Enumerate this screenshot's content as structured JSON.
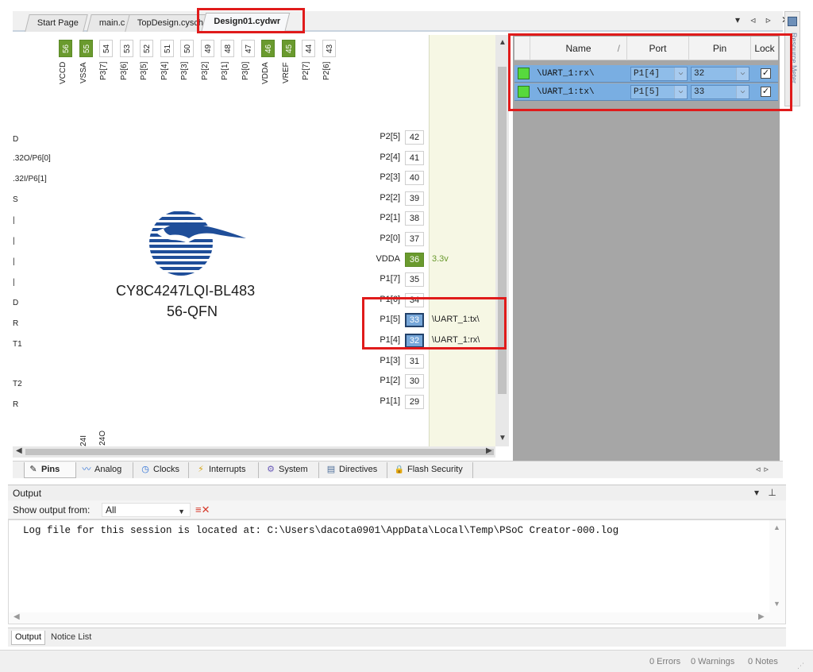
{
  "editor_tabs": [
    {
      "label": "Start Page"
    },
    {
      "label": "main.c"
    },
    {
      "label": "TopDesign.cysch"
    },
    {
      "label": "Design01.cydwr"
    }
  ],
  "tab_controls": "▾ ◃ ▹ ✕",
  "right_strip_text": "Resource Meter",
  "chip": {
    "name": "CY8C4247LQI-BL483",
    "package": "56-QFN",
    "top_pins": [
      {
        "num": "56",
        "name": "VCCD",
        "green": true
      },
      {
        "num": "55",
        "name": "VSSA",
        "green": true
      },
      {
        "num": "54",
        "name": "P3[7]",
        "green": false
      },
      {
        "num": "53",
        "name": "P3[6]",
        "green": false
      },
      {
        "num": "52",
        "name": "P3[5]",
        "green": false
      },
      {
        "num": "51",
        "name": "P3[4]",
        "green": false
      },
      {
        "num": "50",
        "name": "P3[3]",
        "green": false
      },
      {
        "num": "49",
        "name": "P3[2]",
        "green": false
      },
      {
        "num": "48",
        "name": "P3[1]",
        "green": false
      },
      {
        "num": "47",
        "name": "P3[0]",
        "green": false
      },
      {
        "num": "46",
        "name": "VDDA",
        "green": true
      },
      {
        "num": "45",
        "name": "VREF",
        "green": true
      },
      {
        "num": "44",
        "name": "P2[7]",
        "green": false
      },
      {
        "num": "43",
        "name": "P2[6]",
        "green": false
      }
    ],
    "left_labels": [
      "D",
      ".32O/P6[0]",
      ".32I/P6[1]",
      "S",
      "|",
      "|",
      "|",
      "|",
      "D",
      "R",
      "T1",
      "T2",
      "R"
    ],
    "right_pins": [
      {
        "name": "P2[5]",
        "num": "42",
        "style": "",
        "signal": ""
      },
      {
        "name": "P2[4]",
        "num": "41",
        "style": "",
        "signal": ""
      },
      {
        "name": "P2[3]",
        "num": "40",
        "style": "",
        "signal": ""
      },
      {
        "name": "P2[2]",
        "num": "39",
        "style": "",
        "signal": ""
      },
      {
        "name": "P2[1]",
        "num": "38",
        "style": "",
        "signal": ""
      },
      {
        "name": "P2[0]",
        "num": "37",
        "style": "",
        "signal": ""
      },
      {
        "name": "VDDA",
        "num": "36",
        "style": "green",
        "signal": "3.3v"
      },
      {
        "name": "P1[7]",
        "num": "35",
        "style": "",
        "signal": ""
      },
      {
        "name": "P1[6]",
        "num": "34",
        "style": "",
        "signal": ""
      },
      {
        "name": "P1[5]",
        "num": "33",
        "style": "blue",
        "signal": "\\UART_1:tx\\"
      },
      {
        "name": "P1[4]",
        "num": "32",
        "style": "blue",
        "signal": "\\UART_1:rx\\"
      },
      {
        "name": "P1[3]",
        "num": "31",
        "style": "",
        "signal": ""
      },
      {
        "name": "P1[2]",
        "num": "30",
        "style": "",
        "signal": ""
      },
      {
        "name": "P1[1]",
        "num": "29",
        "style": "",
        "signal": ""
      }
    ],
    "bottom_pins": [
      "24I",
      "24O"
    ]
  },
  "pin_table": {
    "headers": {
      "name": "Name",
      "sort": "/",
      "port": "Port",
      "pin": "Pin",
      "lock": "Lock"
    },
    "rows": [
      {
        "name": "\\UART_1:rx\\",
        "port": "P1[4]",
        "pin": "32",
        "lock": "✓",
        "color": "#57d93d"
      },
      {
        "name": "\\UART_1:tx\\",
        "port": "P1[5]",
        "pin": "33",
        "lock": "✓",
        "color": "#57d93d"
      }
    ]
  },
  "bottom_tabs": [
    {
      "label": "Pins",
      "icon": "pins-icon",
      "glyph": "✎"
    },
    {
      "label": "Analog",
      "icon": "analog-icon",
      "glyph": "〰"
    },
    {
      "label": "Clocks",
      "icon": "clock-icon",
      "glyph": "◷"
    },
    {
      "label": "Interrupts",
      "icon": "interrupt-icon",
      "glyph": "⚡"
    },
    {
      "label": "System",
      "icon": "system-icon",
      "glyph": "⚙"
    },
    {
      "label": "Directives",
      "icon": "directives-icon",
      "glyph": "▤"
    },
    {
      "label": "Flash Security",
      "icon": "flash-security-icon",
      "glyph": "🔒"
    }
  ],
  "output": {
    "title": "Output",
    "title_controls": "▾ ⊥ ✕",
    "show_from_label": "Show output from:",
    "show_from_value": "All",
    "log_text": "Log file for this session is located at: C:\\Users\\dacota0901\\AppData\\Local\\Temp\\PSoC Creator-000.log",
    "tabs": [
      "Output",
      "Notice List"
    ]
  },
  "status": {
    "errors": "0 Errors",
    "warnings": "0 Warnings",
    "notes": "0 Notes"
  },
  "colors": {
    "highlight": "#e01b1b",
    "pin_green": "#6a9a2e",
    "row_blue": "#79aee2"
  }
}
